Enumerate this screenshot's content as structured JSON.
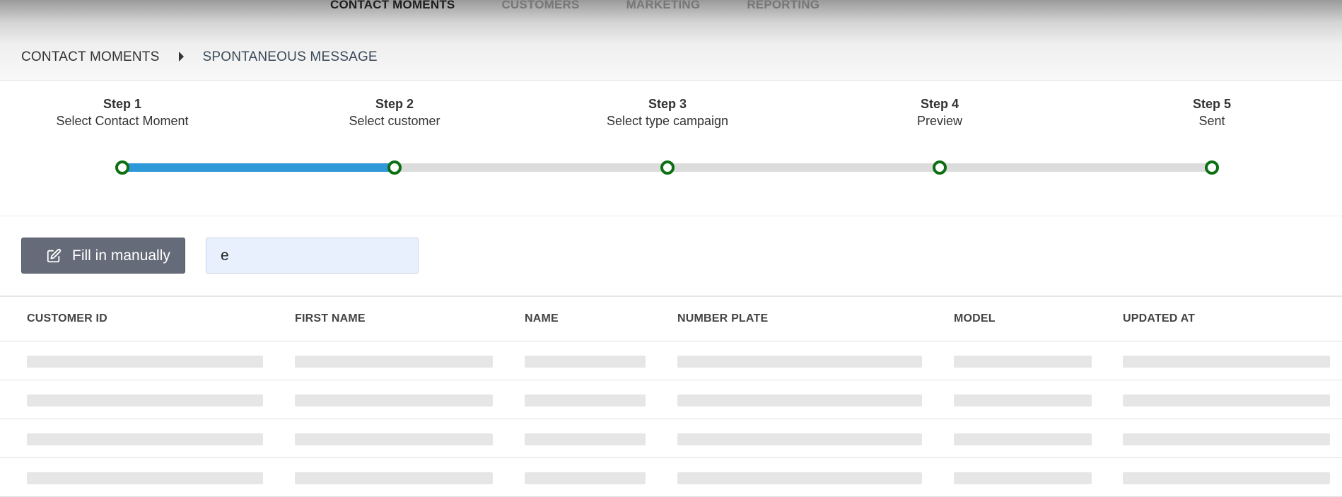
{
  "topnav": {
    "items": [
      {
        "label": "CONTACT MOMENTS",
        "active": true
      },
      {
        "label": "CUSTOMERS",
        "active": false
      },
      {
        "label": "MARKETING",
        "active": false
      },
      {
        "label": "REPORTING",
        "active": false
      }
    ]
  },
  "breadcrumb": {
    "root": "CONTACT MOMENTS",
    "current": "SPONTANEOUS MESSAGE"
  },
  "stepper": {
    "progress_fraction": 0.25,
    "steps": [
      {
        "number": "Step 1",
        "label": "Select Contact Moment"
      },
      {
        "number": "Step 2",
        "label": "Select customer"
      },
      {
        "number": "Step 3",
        "label": "Select type campaign"
      },
      {
        "number": "Step 4",
        "label": "Preview"
      },
      {
        "number": "Step 5",
        "label": "Sent"
      }
    ]
  },
  "toolbar": {
    "fill_manually_label": "Fill in manually",
    "fill_manually_icon": "edit-icon",
    "search_value": "e"
  },
  "table": {
    "columns": [
      "CUSTOMER ID",
      "FIRST NAME",
      "NAME",
      "NUMBER PLATE",
      "MODEL",
      "UPDATED AT"
    ],
    "loading_rows": 4
  },
  "colors": {
    "progress_fill": "#2f98d8",
    "step_dot_border": "#0c6f12",
    "button_bg": "#656b78",
    "input_bg": "#e8f0fe"
  }
}
